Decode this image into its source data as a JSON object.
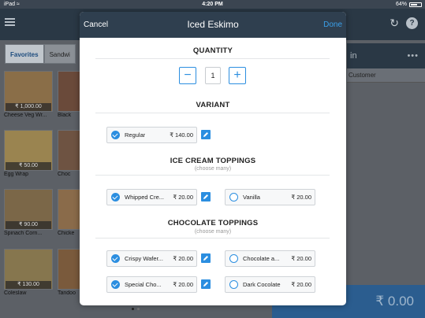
{
  "status_bar": {
    "device": "iPad",
    "time": "4:20 PM",
    "battery": "64%",
    "battery_level": 0.64
  },
  "background": {
    "tabs": [
      "Favorites",
      "Sandwi"
    ],
    "tiles": [
      {
        "name": "Cheese Veg Wr...",
        "price": "₹ 1,000.00"
      },
      {
        "name": "Black",
        "price": ""
      },
      {
        "name": "Egg Wrap",
        "price": "₹ 50.00"
      },
      {
        "name": "Choc",
        "price": ""
      },
      {
        "name": "Spinach Corn...",
        "price": "₹ 90.00"
      },
      {
        "name": "Chicke",
        "price": ""
      },
      {
        "name": "Coleslaw",
        "price": "₹ 130.00"
      },
      {
        "name": "Tandoo",
        "price": ""
      }
    ],
    "right_bar_label": "in",
    "right_customer": "Customer",
    "total": "₹ 0.00"
  },
  "modal": {
    "cancel_label": "Cancel",
    "title": "Iced Eskimo",
    "done_label": "Done",
    "quantity": {
      "title": "QUANTITY",
      "value": "1",
      "minus": "−",
      "plus": "+"
    },
    "variant": {
      "title": "VARIANT",
      "options": [
        {
          "label": "Regular",
          "price": "₹ 140.00",
          "selected": true
        }
      ]
    },
    "ice_cream_toppings": {
      "title": "ICE CREAM TOPPINGS",
      "subtitle": "(choose many)",
      "options": [
        {
          "label": "Whipped Cre...",
          "price": "₹ 20.00",
          "selected": true
        },
        {
          "label": "Vanilla",
          "price": "₹ 20.00",
          "selected": false
        }
      ]
    },
    "chocolate_toppings": {
      "title": "CHOCOLATE TOPPINGS",
      "subtitle": "(choose many)",
      "options": [
        {
          "label": "Crispy Wafer...",
          "price": "₹ 20.00",
          "selected": true
        },
        {
          "label": "Chocolate a...",
          "price": "₹ 20.00",
          "selected": false
        },
        {
          "label": "Special Cho...",
          "price": "₹ 20.00",
          "selected": true
        },
        {
          "label": "Dark Cocolate",
          "price": "₹ 20.00",
          "selected": false
        }
      ]
    }
  },
  "colors": {
    "accent": "#2b8ee0",
    "header": "#2f3f4f",
    "done": "#3aa0ea"
  },
  "icons": [
    "wifi-icon",
    "battery-icon",
    "menu-icon",
    "sync-icon",
    "help-icon",
    "check-icon",
    "pencil-icon",
    "minus-icon",
    "plus-icon"
  ]
}
